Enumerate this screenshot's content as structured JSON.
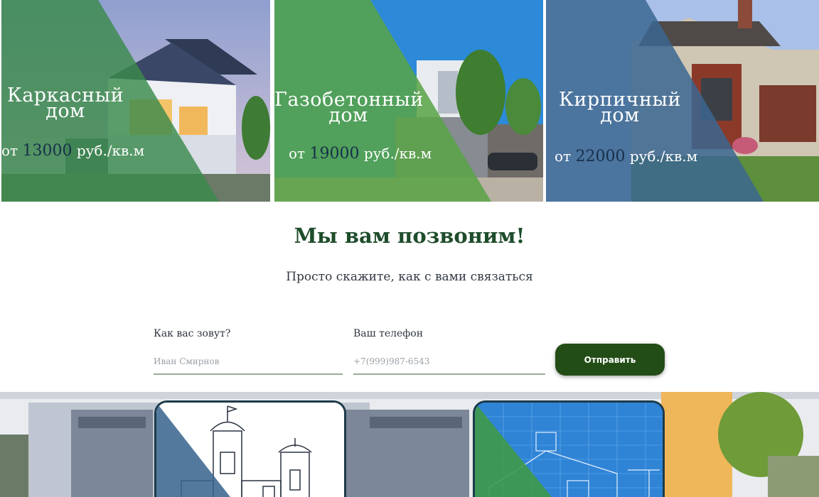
{
  "cards": [
    {
      "title_line1": "Каркасный",
      "title_line2": "дом",
      "price_prefix": "от",
      "price_value": "13000",
      "price_unit": "руб./кв.м",
      "overlay_color": "#3a8a4c"
    },
    {
      "title_line1": "Газобетонный",
      "title_line2": "дом",
      "price_prefix": "от",
      "price_value": "19000",
      "price_unit": "руб./кв.м",
      "overlay_color": "#58a345"
    },
    {
      "title_line1": "Кирпичный",
      "title_line2": "дом",
      "price_prefix": "от",
      "price_value": "22000",
      "price_unit": "руб./кв.м",
      "overlay_color": "#3b6690"
    }
  ],
  "callback": {
    "headline": "Мы вам позвоним!",
    "subline": "Просто скажите, как с вами связаться",
    "name_label": "Как вас зовут?",
    "name_placeholder": "Иван Смирнов",
    "phone_label": "Ваш телефон",
    "phone_placeholder": "+7(999)987-6543",
    "submit_label": "Отправить"
  },
  "colors": {
    "accent_green": "#1e4d2b",
    "button_green": "#234d16",
    "price_number": "#17304a"
  }
}
